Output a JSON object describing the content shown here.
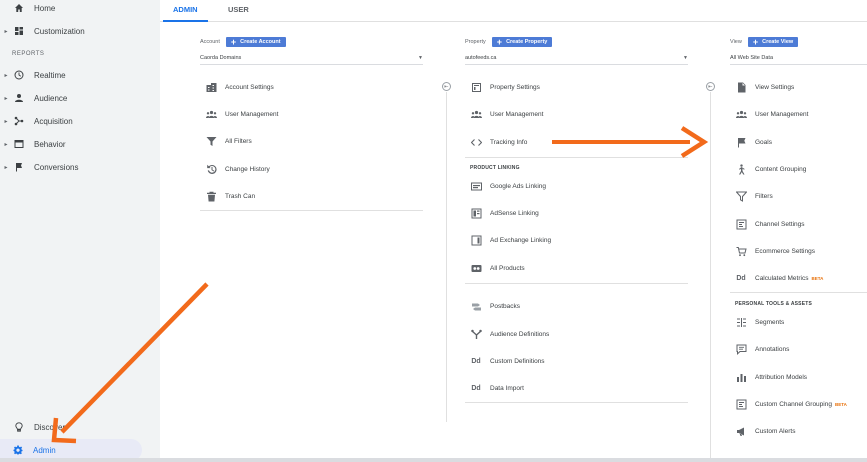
{
  "sidebar": {
    "items": [
      {
        "label": "Home",
        "icon": "home-icon"
      },
      {
        "label": "Customization",
        "icon": "dashboard-icon"
      },
      {
        "label": "Realtime",
        "icon": "clock-icon"
      },
      {
        "label": "Audience",
        "icon": "person-icon"
      },
      {
        "label": "Acquisition",
        "icon": "acquisition-icon"
      },
      {
        "label": "Behavior",
        "icon": "behavior-icon"
      },
      {
        "label": "Conversions",
        "icon": "flag-icon"
      }
    ],
    "section_reports": "REPORTS",
    "discover": "Discover",
    "admin": "Admin"
  },
  "tabs": {
    "admin": "ADMIN",
    "user": "USER"
  },
  "account": {
    "label": "Account",
    "create": "Create Account",
    "selected": "Caorda Domains",
    "items": [
      "Account Settings",
      "User Management",
      "All Filters",
      "Change History",
      "Trash Can"
    ]
  },
  "property": {
    "label": "Property",
    "create": "Create Property",
    "selected": "autofeeds.ca",
    "items": [
      "Property Settings",
      "User Management",
      "Tracking Info"
    ],
    "section_linking": "PRODUCT LINKING",
    "linking_items": [
      "Google Ads Linking",
      "AdSense Linking",
      "Ad Exchange Linking",
      "All Products"
    ],
    "other_items": [
      "Postbacks",
      "Audience Definitions",
      "Custom Definitions",
      "Data Import"
    ]
  },
  "view": {
    "label": "View",
    "create": "Create View",
    "selected": "All Web Site Data",
    "items": [
      "View Settings",
      "User Management",
      "Goals",
      "Content Grouping",
      "Filters",
      "Channel Settings",
      "Ecommerce Settings",
      "Calculated Metrics"
    ],
    "section_personal": "PERSONAL TOOLS & ASSETS",
    "personal_items": [
      "Segments",
      "Annotations",
      "Attribution Models",
      "Custom Channel Grouping",
      "Custom Alerts"
    ],
    "beta": "BETA"
  },
  "colors": {
    "accent": "#1a73e8",
    "button": "#4d7bd6",
    "annotation": "#f26a1b"
  }
}
